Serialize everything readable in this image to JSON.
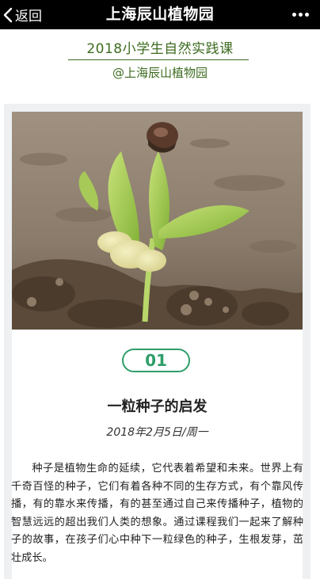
{
  "topbar": {
    "back_label": "返回",
    "title": "上海辰山植物园"
  },
  "header": {
    "course_title": "2018小学生自然实践课",
    "org_handle": "@上海辰山植物园"
  },
  "lesson": {
    "number": "01",
    "title": "一粒种子的启发",
    "date": "2018年2月5日/周一",
    "body": "种子是植物生命的延续，它代表着希望和未来。世界上有千奇百怪的种子，它们有着各种不同的生存方式，有个靠风传播，有的靠水来传播，有的甚至通过自己来传播种子，植物的智慧远远的超出我们人类的想象。通过课程我们一起来了解种子的故事，在孩子们心中种下一粒绿色的种子，生根发芽，茁壮成长。"
  },
  "colors": {
    "topbar_bg": "#000000",
    "heading_green": "#3d6b1f",
    "badge_green": "#2e9e6a",
    "card_bg": "#eef0f2"
  },
  "icons": {
    "back": "chevron-left-icon",
    "more": "more-dots-icon"
  }
}
